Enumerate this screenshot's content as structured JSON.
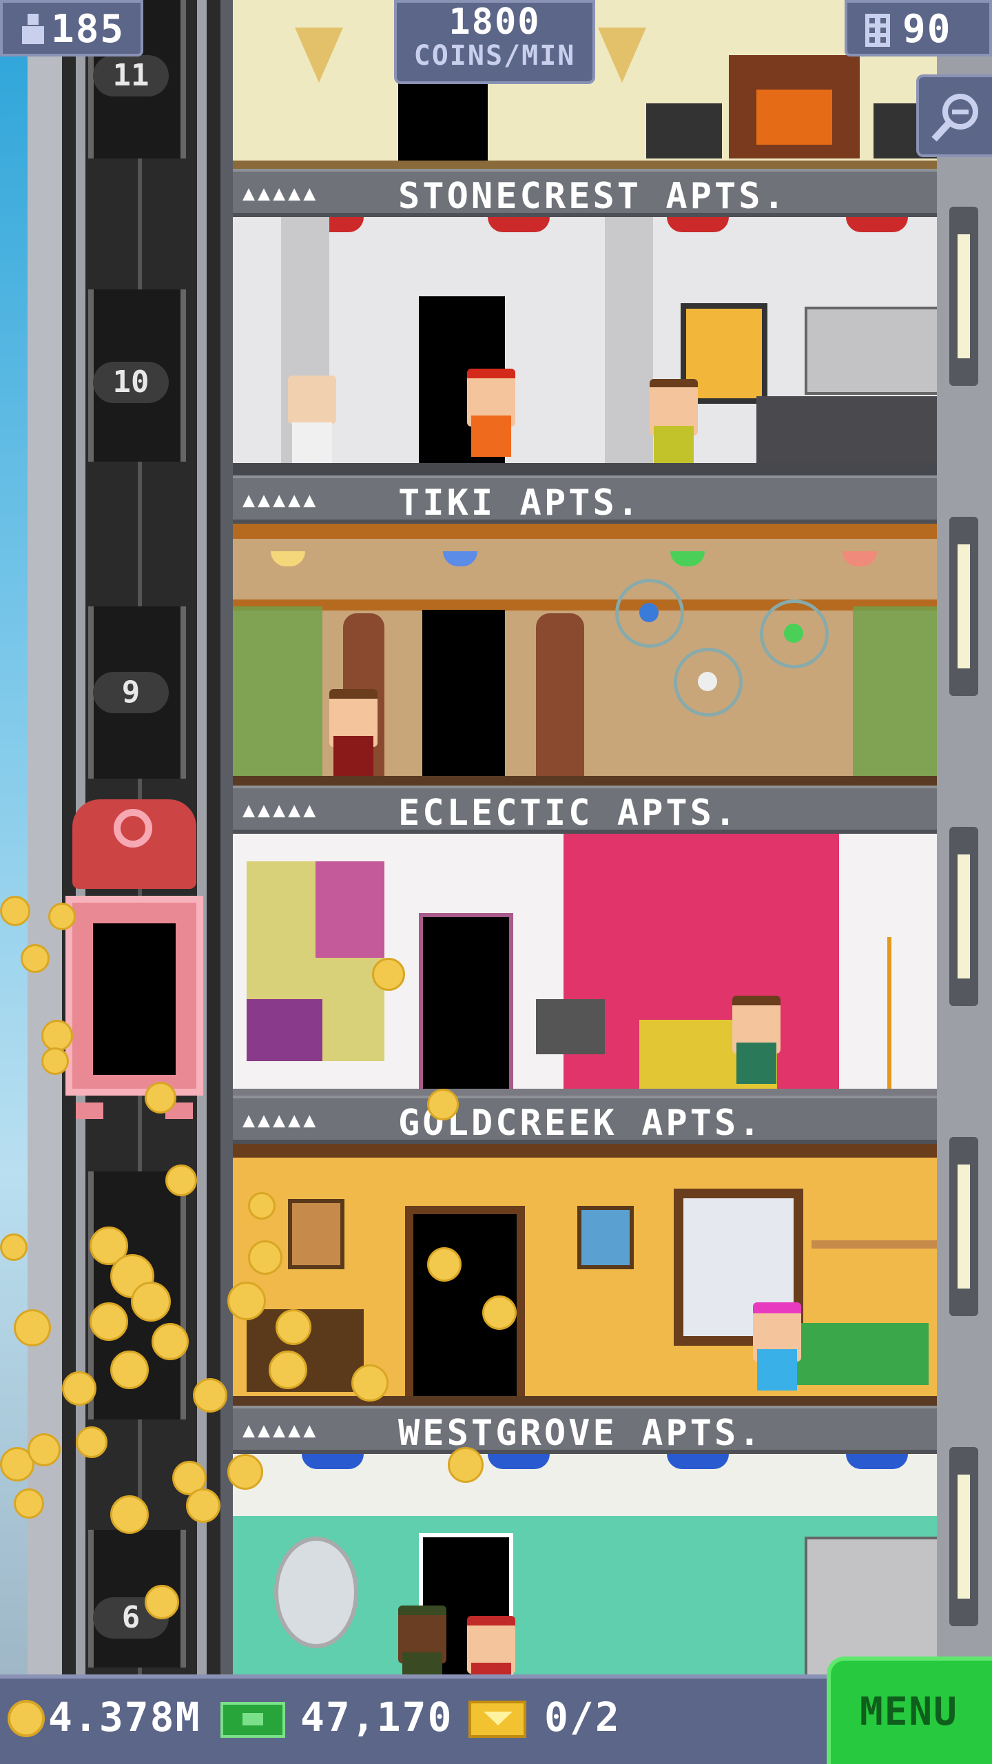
{
  "hud": {
    "population": "185",
    "coins_per_min_value": "1800",
    "coins_per_min_label": "COINS/MIN",
    "floors": "90"
  },
  "elevator_shaft": {
    "floor_numbers": [
      "11",
      "10",
      "9",
      "6"
    ]
  },
  "floors": [
    {
      "name": "STONECREST APTS.",
      "stars": "▲▲▲▲▲"
    },
    {
      "name": "TIKI APTS.",
      "stars": "▲▲▲▲▲"
    },
    {
      "name": "ECLECTIC APTS.",
      "stars": "▲▲▲▲▲"
    },
    {
      "name": "GOLDCREEK APTS.",
      "stars": "▲▲▲▲▲"
    },
    {
      "name": "WESTGROVE APTS.",
      "stars": "▲▲▲▲▲"
    }
  ],
  "bottom_bar": {
    "coins": "4.378M",
    "bux": "47,170",
    "tickets": "0/2",
    "menu_label": "MENU"
  },
  "colors": {
    "hud_bg": "#5c6688",
    "menu_green": "#27c93f",
    "coin_gold": "#f2c94c"
  }
}
